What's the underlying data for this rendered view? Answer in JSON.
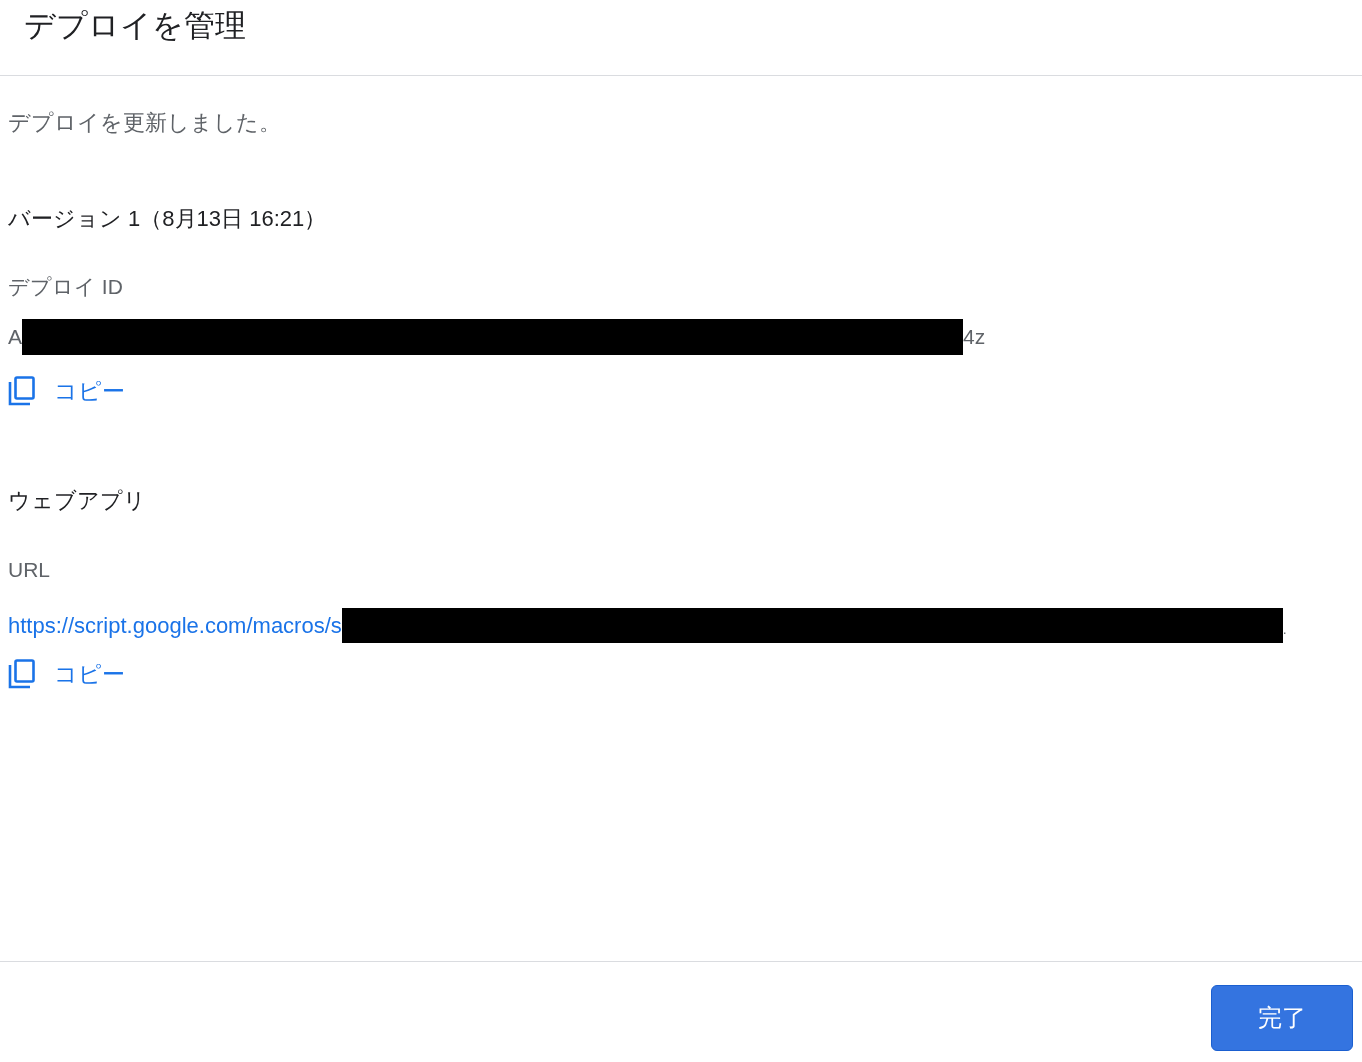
{
  "dialog": {
    "title": "デプロイを管理"
  },
  "message": "デプロイを更新しました。",
  "version_heading": "バージョン 1（8月13日 16:21）",
  "deployment_id": {
    "label": "デプロイ ID",
    "value_start": "A",
    "value_end": "4z",
    "redacted": true,
    "copy_label": "コピー"
  },
  "web_app": {
    "heading": "ウェブアプリ",
    "label": "URL",
    "url_start": "https://script.google.com/macros/s",
    "url_end": ".",
    "redacted": true,
    "copy_label": "コピー"
  },
  "buttons": [
    {
      "label": "完了",
      "kind": "primary"
    }
  ]
}
